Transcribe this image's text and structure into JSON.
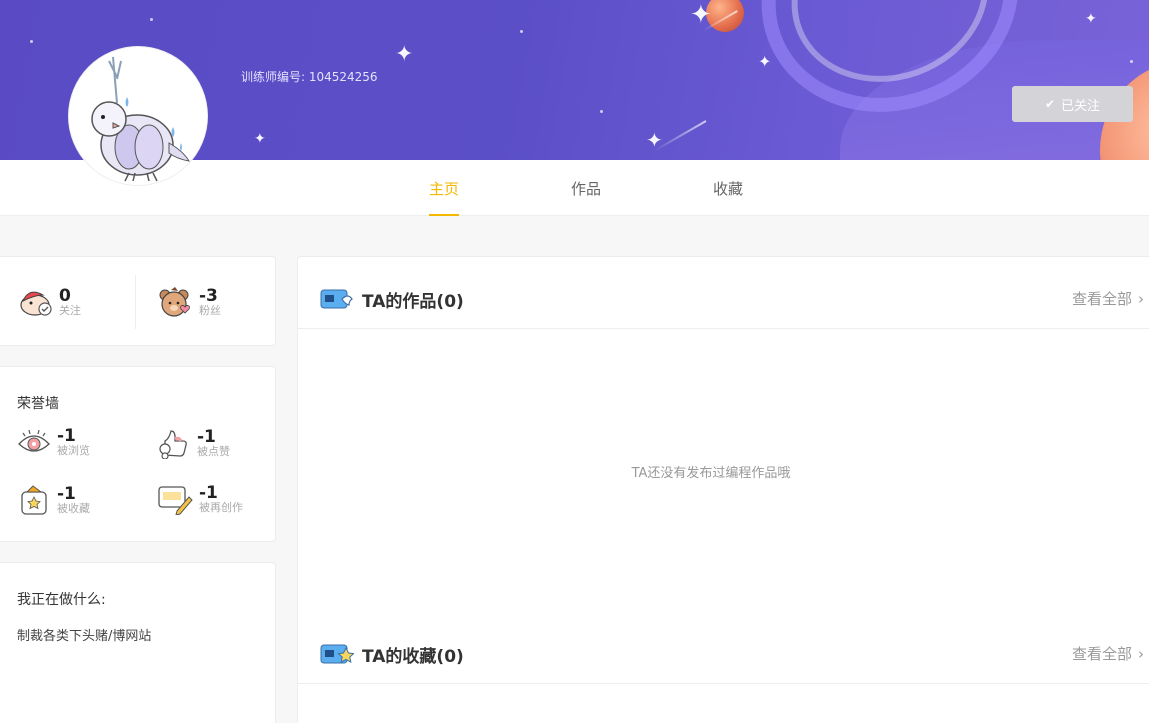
{
  "banner": {
    "trainer_id": "训练师编号: 104524256",
    "follow_button": "已关注"
  },
  "tabs": [
    {
      "label": "主页",
      "active": true
    },
    {
      "label": "作品",
      "active": false
    },
    {
      "label": "收藏",
      "active": false
    }
  ],
  "stats": {
    "following": {
      "value": "0",
      "label": "关注"
    },
    "fans": {
      "value": "-3",
      "label": "粉丝"
    }
  },
  "honor": {
    "title": "荣誉墙",
    "items": [
      {
        "value": "-1",
        "label": "被浏览"
      },
      {
        "value": "-1",
        "label": "被点赞"
      },
      {
        "value": "-1",
        "label": "被收藏"
      },
      {
        "value": "-1",
        "label": "被再创作"
      }
    ]
  },
  "doing": {
    "title": "我正在做什么:",
    "text": "制裁各类下头赌/博网站"
  },
  "works": {
    "title": "TA的作品(0)",
    "more": "查看全部",
    "empty": "TA还没有发布过编程作品哦"
  },
  "favorites": {
    "title": "TA的收藏(0)",
    "more": "查看全部"
  },
  "colors": {
    "accent": "#f5b800",
    "banner": "#5a4bc4",
    "muted": "#999999"
  }
}
